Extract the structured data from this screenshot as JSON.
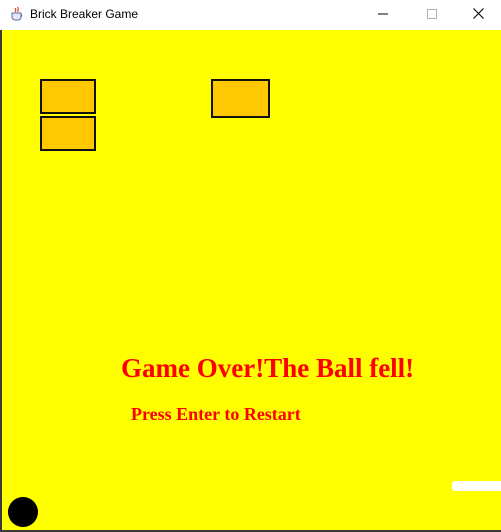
{
  "window": {
    "title": "Brick Breaker Game",
    "icon": "java-coffee-cup-icon"
  },
  "controls": {
    "minimize_icon": "minimize-icon",
    "maximize_icon": "maximize-icon",
    "close_icon": "close-icon"
  },
  "game": {
    "background_color": "#ffff00",
    "brick_color": "#ffc800",
    "brick_border_color": "#111111",
    "message_color": "#ff0000",
    "paddle_color": "#ffffff",
    "ball_color": "#000000",
    "game_over_message": "Game Over!The Ball fell!",
    "restart_message": "Press Enter to Restart",
    "bricks_remaining": 3
  }
}
